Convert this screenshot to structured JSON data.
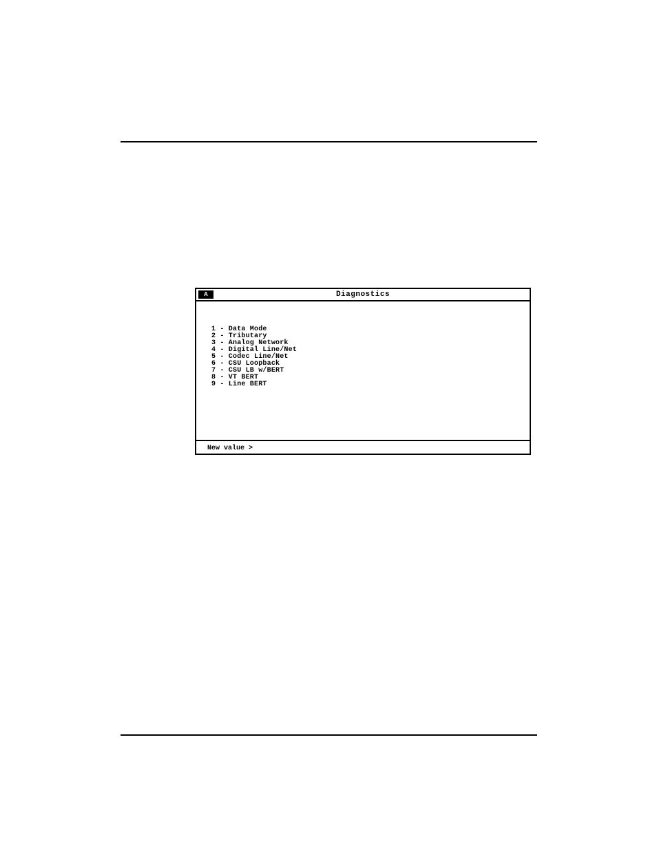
{
  "terminal": {
    "badge": "A",
    "title": "Diagnostics",
    "menu": [
      {
        "num": "1",
        "label": "Data Mode"
      },
      {
        "num": "2",
        "label": "Tributary"
      },
      {
        "num": "3",
        "label": "Analog Network"
      },
      {
        "num": "4",
        "label": "Digital Line/Net"
      },
      {
        "num": "5",
        "label": "Codec Line/Net"
      },
      {
        "num": "6",
        "label": "CSU Loopback"
      },
      {
        "num": "7",
        "label": "CSU LB w/BERT"
      },
      {
        "num": "8",
        "label": "VT BERT"
      },
      {
        "num": "9",
        "label": "Line BERT"
      }
    ],
    "status_prompt": "New value >"
  }
}
